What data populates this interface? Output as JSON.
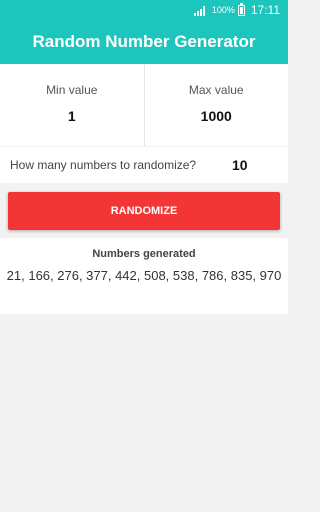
{
  "status_bar": {
    "battery_percent": "100%",
    "time": "17:11"
  },
  "app": {
    "title": "Random Number Generator"
  },
  "range": {
    "min_label": "Min value",
    "min_value": "1",
    "max_label": "Max value",
    "max_value": "1000"
  },
  "count": {
    "label": "How many numbers to randomize?",
    "value": "10"
  },
  "randomize_button": "RANDOMIZE",
  "results": {
    "title": "Numbers generated",
    "numbers": "21, 166, 276, 377, 442, 508, 538, 786, 835, 970"
  }
}
